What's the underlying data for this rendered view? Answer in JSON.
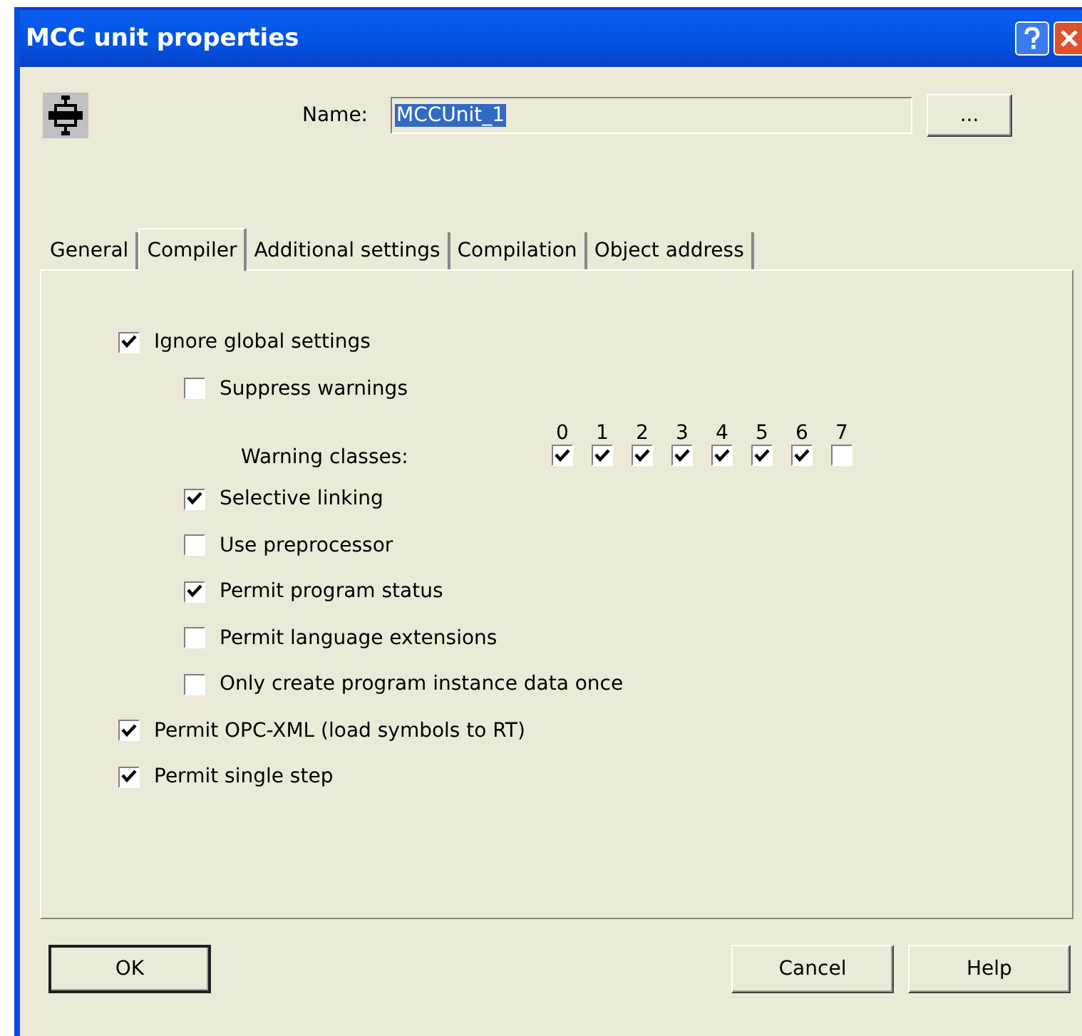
{
  "window": {
    "title": "MCC unit properties"
  },
  "name_field": {
    "label": "Name:",
    "value": "MCCUnit_1",
    "browse_label": "..."
  },
  "tabs": [
    {
      "label": "General",
      "selected": false
    },
    {
      "label": "Compiler",
      "selected": true
    },
    {
      "label": "Additional settings",
      "selected": false
    },
    {
      "label": "Compilation",
      "selected": false
    },
    {
      "label": "Object address",
      "selected": false
    }
  ],
  "options": [
    {
      "kind": "checkbox",
      "label": "Ignore global settings",
      "checked": true,
      "children": [
        {
          "kind": "checkbox",
          "label": "Suppress warnings",
          "checked": false
        },
        {
          "kind": "classes",
          "label": "Warning classes:",
          "classes": [
            {
              "label": "0",
              "checked": true
            },
            {
              "label": "1",
              "checked": true
            },
            {
              "label": "2",
              "checked": true
            },
            {
              "label": "3",
              "checked": true
            },
            {
              "label": "4",
              "checked": true
            },
            {
              "label": "5",
              "checked": true
            },
            {
              "label": "6",
              "checked": true
            },
            {
              "label": "7",
              "checked": false
            }
          ]
        },
        {
          "kind": "checkbox",
          "label": "Selective linking",
          "checked": true
        },
        {
          "kind": "checkbox",
          "label": "Use preprocessor",
          "checked": false
        },
        {
          "kind": "checkbox",
          "label": "Permit program status",
          "checked": true
        },
        {
          "kind": "checkbox",
          "label": "Permit language extensions",
          "checked": false
        },
        {
          "kind": "checkbox",
          "label": "Only create program instance data once",
          "checked": false
        }
      ]
    },
    {
      "kind": "checkbox",
      "label": "Permit OPC-XML (load symbols to RT)",
      "checked": true
    },
    {
      "kind": "checkbox",
      "label": "Permit single step",
      "checked": true
    }
  ],
  "buttons": [
    {
      "label": "OK",
      "default": true
    },
    {
      "label": "Cancel",
      "default": false
    },
    {
      "label": "Help",
      "default": false
    }
  ]
}
